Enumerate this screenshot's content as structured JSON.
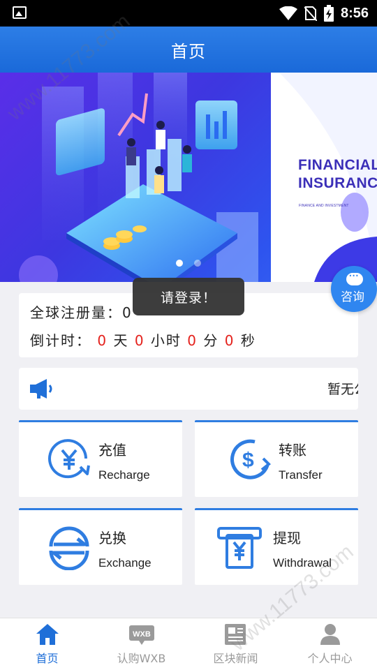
{
  "status_bar": {
    "time": "8:56"
  },
  "header": {
    "title": "首页"
  },
  "banner": {
    "title_line1": "FINANCIAL",
    "title_line2": "INSURANCE",
    "subtitle": "FINANCE AND INVESTMENT",
    "page_index": 1,
    "page_count": 2
  },
  "info": {
    "registered_label": "全球注册量：",
    "registered_value": "0",
    "countdown_label": "倒计时：",
    "days": "0",
    "days_unit": "天",
    "hours": "0",
    "hours_unit": "小时",
    "minutes": "0",
    "minutes_unit": "分",
    "seconds": "0",
    "seconds_unit": "秒"
  },
  "toast": {
    "text": "请登录！"
  },
  "consult": {
    "label": "咨询"
  },
  "notice": {
    "text": "暂无公告"
  },
  "functions": [
    {
      "cn": "充值",
      "en": "Recharge",
      "icon": "yen-refresh-icon"
    },
    {
      "cn": "转账",
      "en": "Transfer",
      "icon": "dollar-transfer-icon"
    },
    {
      "cn": "兑换",
      "en": "Exchange",
      "icon": "exchange-arrows-icon"
    },
    {
      "cn": "提现",
      "en": "Withdrawal",
      "icon": "atm-yen-icon"
    }
  ],
  "nav": [
    {
      "label": "首页",
      "icon": "home-icon",
      "active": true
    },
    {
      "label": "认购WXB",
      "icon": "wxb-icon",
      "badge": "WXB",
      "active": false
    },
    {
      "label": "区块新闻",
      "icon": "news-icon",
      "active": false
    },
    {
      "label": "个人中心",
      "icon": "person-icon",
      "active": false
    }
  ],
  "watermark": "www.11773.com",
  "colors": {
    "primary": "#1f6fd8",
    "accent_red": "#e4211c",
    "inactive": "#9a9a9a"
  }
}
